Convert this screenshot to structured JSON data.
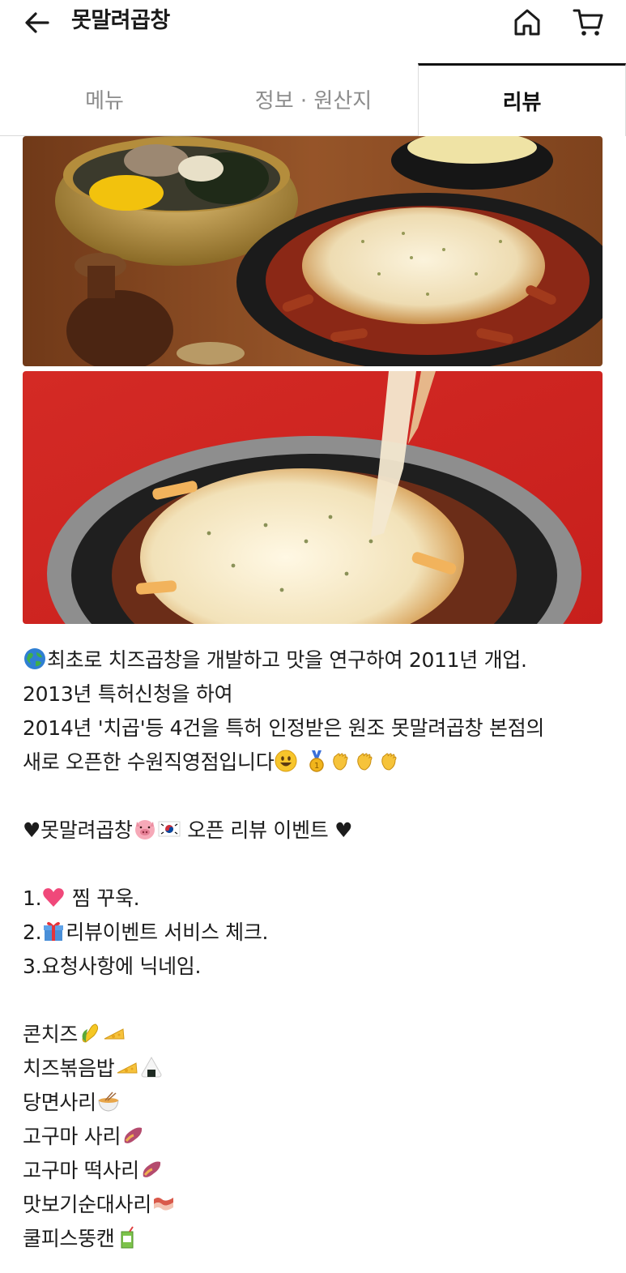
{
  "header": {
    "title": "못말려곱창"
  },
  "tabs": [
    {
      "label": "메뉴"
    },
    {
      "label": "정보 · 원산지"
    },
    {
      "label": "리뷰"
    }
  ],
  "review": {
    "intro1": "최초로 치즈곱창을 개발하고 맛을 연구하여 2011년 개업.",
    "intro2": "2013년 특허신청을 하여",
    "intro3": "2014년 '치곱'등 4건을 특허 인정받은 원조 못말려곱창 본점의",
    "intro4": "새로 오픈한 수원직영점입니다",
    "event_prefix": "♥못말려곱창",
    "event_suffix": " 오픈 리뷰 이벤트 ♥",
    "step1_num": "1.",
    "step1_text": " 찜 꾸욱.",
    "step2_num": "2.",
    "step2_text": "리뷰이벤트 서비스 체크.",
    "step3": "3.요청사항에 닉네임.",
    "options": [
      "콘치즈",
      "치즈볶음밥",
      "당면사리",
      "고구마 사리",
      "고구마 떡사리",
      "맛보기순대사리",
      "쿨피스뚱캔"
    ]
  },
  "icons": {
    "back": "arrow-left-icon",
    "home": "home-icon",
    "cart": "cart-icon"
  },
  "colors": {
    "active_tab_border": "#111111",
    "inactive_tab_text": "#8c8c8c",
    "photo2_background": "#d42a25"
  }
}
